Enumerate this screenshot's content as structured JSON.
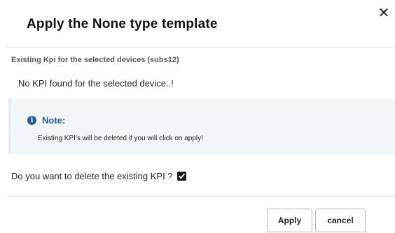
{
  "dialog": {
    "title": "Apply the None type template",
    "close_symbol": "✕",
    "close_icon": "close-icon"
  },
  "existing": {
    "section_label": "Existing Kpi for the selected devices (subs12)",
    "empty_message": "No KPI found for the selected device..!"
  },
  "note": {
    "icon": "info-icon",
    "icon_glyph": "i",
    "title": "Note:",
    "text": "Existing KPI's will be deleted if you will click on apply!",
    "color": "#2a5d8f",
    "background": "#f1f6f9"
  },
  "confirm": {
    "label": "Do you want to delete the existing KPI ?",
    "checked": true
  },
  "actions": {
    "apply_label": "Apply",
    "cancel_label": "cancel"
  }
}
